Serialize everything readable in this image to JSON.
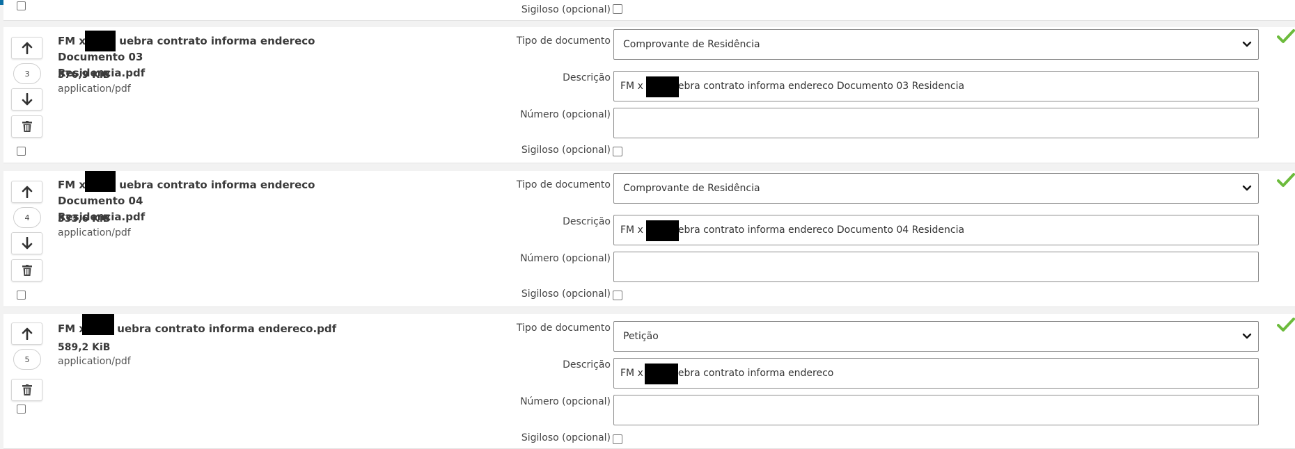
{
  "labels": {
    "tipo": "Tipo de documento",
    "descricao": "Descrição",
    "numero": "Número (opcional)",
    "sigiloso": "Sigiloso (opcional)"
  },
  "colors": {
    "topbar": "#0b6fa4",
    "check": "#6cbb3c"
  },
  "icons": [
    "arrow-up-icon",
    "arrow-down-icon",
    "trash-icon",
    "chevron-down-icon",
    "checkmark-icon"
  ],
  "documents": [
    {
      "name_part1": "FM x ",
      "name_part2": "uebra contrato informa endereco Documento 03",
      "name_line2": "Residencia.pdf",
      "size": "376,9 KiB",
      "mime": "application/pdf",
      "order": "3",
      "tipo": "Comprovante de Residência",
      "descricao_part1": "FM x ",
      "descricao_part2": "ebra contrato informa endereco Documento 03 Residencia",
      "numero": ""
    },
    {
      "name_part1": "FM x ",
      "name_part2": "uebra contrato informa endereco Documento 04",
      "name_line2": "Residencia.pdf",
      "size": "333,6 KiB",
      "mime": "application/pdf",
      "order": "4",
      "tipo": "Comprovante de Residência",
      "descricao_part1": "FM x ",
      "descricao_part2": "ebra contrato informa endereco Documento 04 Residencia",
      "numero": ""
    },
    {
      "name_part1": "FM x ",
      "name_part2": "uebra contrato informa endereco.pdf",
      "name_line2": "",
      "size": "589,2 KiB",
      "mime": "application/pdf",
      "order": "5",
      "tipo": "Petição",
      "descricao_part1": "FM x ",
      "descricao_part2": "ebra contrato informa endereco",
      "numero": ""
    }
  ]
}
